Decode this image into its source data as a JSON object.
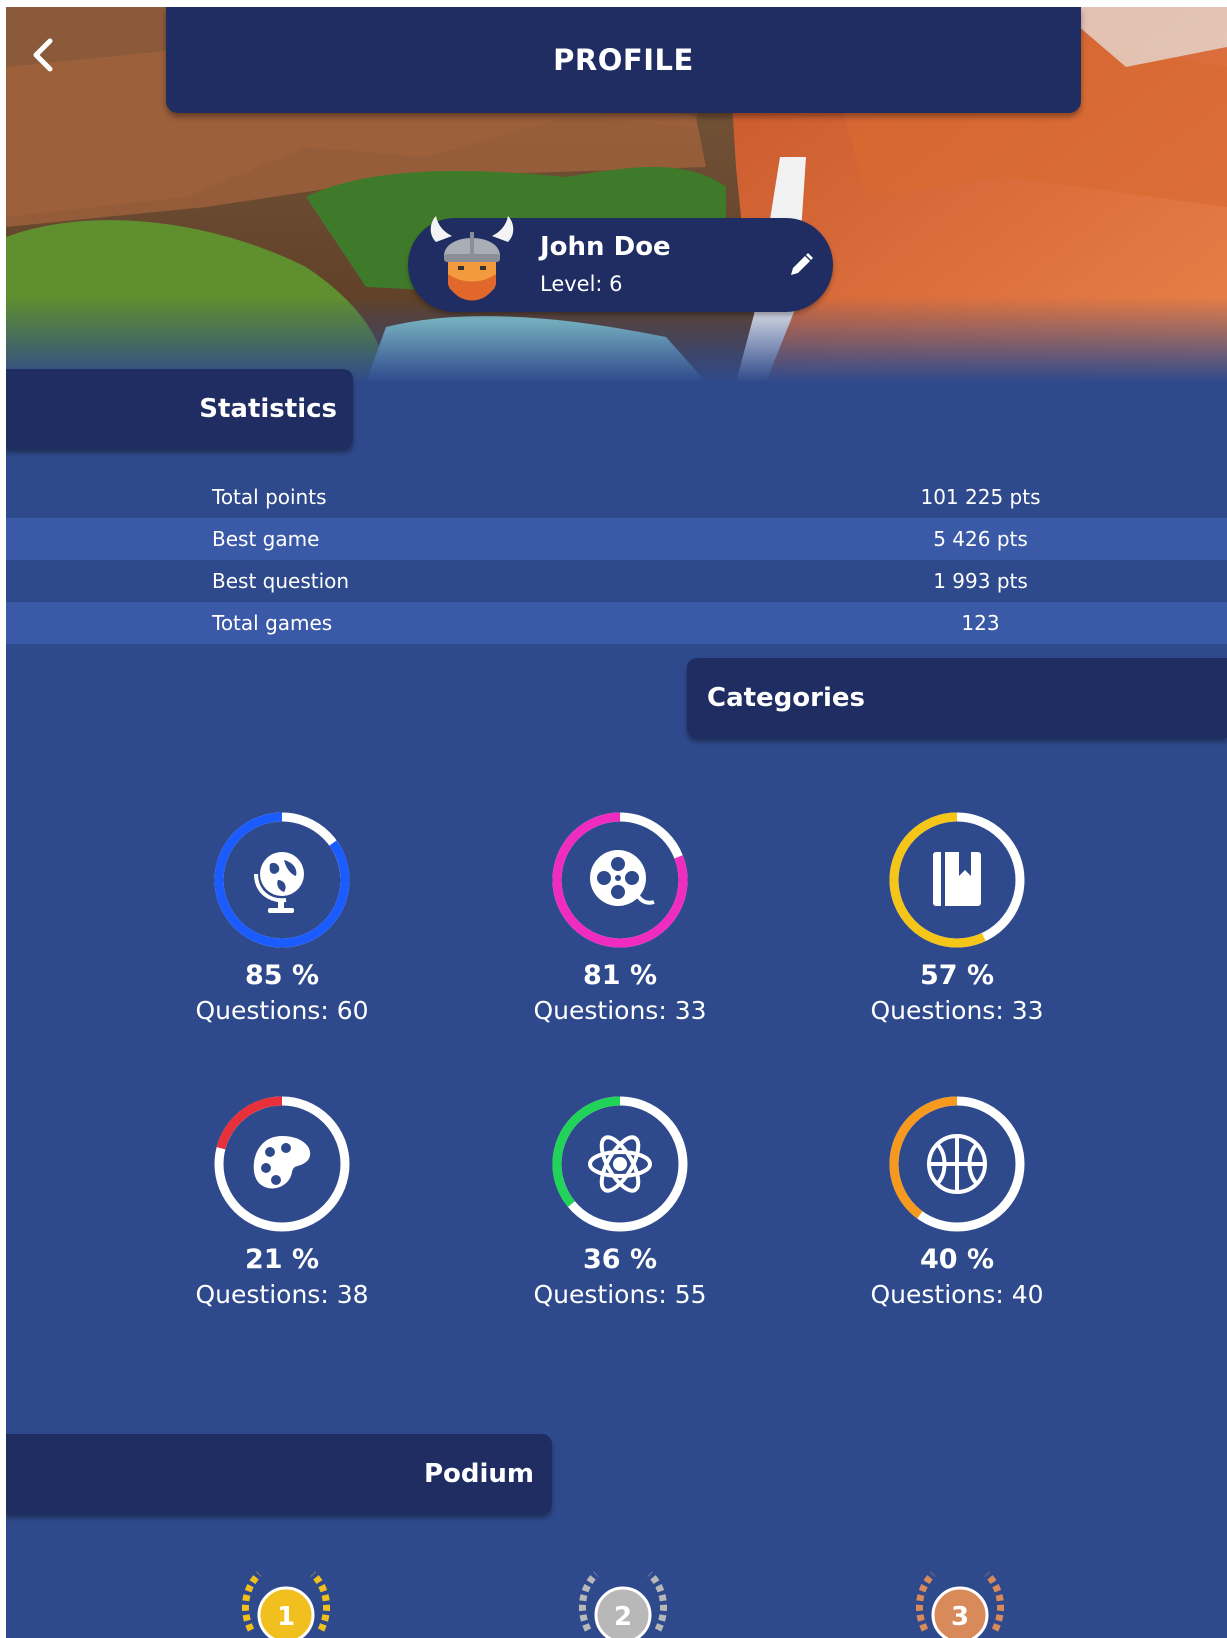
{
  "header": {
    "title": "PROFILE"
  },
  "profile": {
    "name": "John Doe",
    "level_text": "Level: 6"
  },
  "sections": {
    "statistics": "Statistics",
    "categories": "Categories",
    "podium": "Podium"
  },
  "statistics": [
    {
      "label": "Total points",
      "value": "101 225 pts"
    },
    {
      "label": "Best game",
      "value": "5 426 pts"
    },
    {
      "label": "Best question",
      "value": "1 993 pts"
    },
    {
      "label": "Total games",
      "value": "123"
    }
  ],
  "categories": [
    {
      "icon": "globe-icon",
      "percent": 85,
      "percent_text": "85 %",
      "questions_text": "Questions: 60",
      "color": "#1a5cff"
    },
    {
      "icon": "film-reel-icon",
      "percent": 81,
      "percent_text": "81 %",
      "questions_text": "Questions: 33",
      "color": "#f02cc0"
    },
    {
      "icon": "book-icon",
      "percent": 57,
      "percent_text": "57 %",
      "questions_text": "Questions: 33",
      "color": "#f5c518"
    },
    {
      "icon": "palette-icon",
      "percent": 21,
      "percent_text": "21 %",
      "questions_text": "Questions: 38",
      "color": "#e8303a"
    },
    {
      "icon": "atom-icon",
      "percent": 36,
      "percent_text": "36 %",
      "questions_text": "Questions: 55",
      "color": "#22d35a"
    },
    {
      "icon": "basketball-icon",
      "percent": 40,
      "percent_text": "40 %",
      "questions_text": "Questions: 40",
      "color": "#f59a1e"
    }
  ],
  "podium": [
    {
      "rank": "1",
      "color": "#f2c01e"
    },
    {
      "rank": "2",
      "color": "#b8b8b8"
    },
    {
      "rank": "3",
      "color": "#d98a5a"
    }
  ],
  "colors": {
    "background": "#2f4a8c",
    "panel": "#1f2d63",
    "row_alt": "#3a5aa8"
  }
}
